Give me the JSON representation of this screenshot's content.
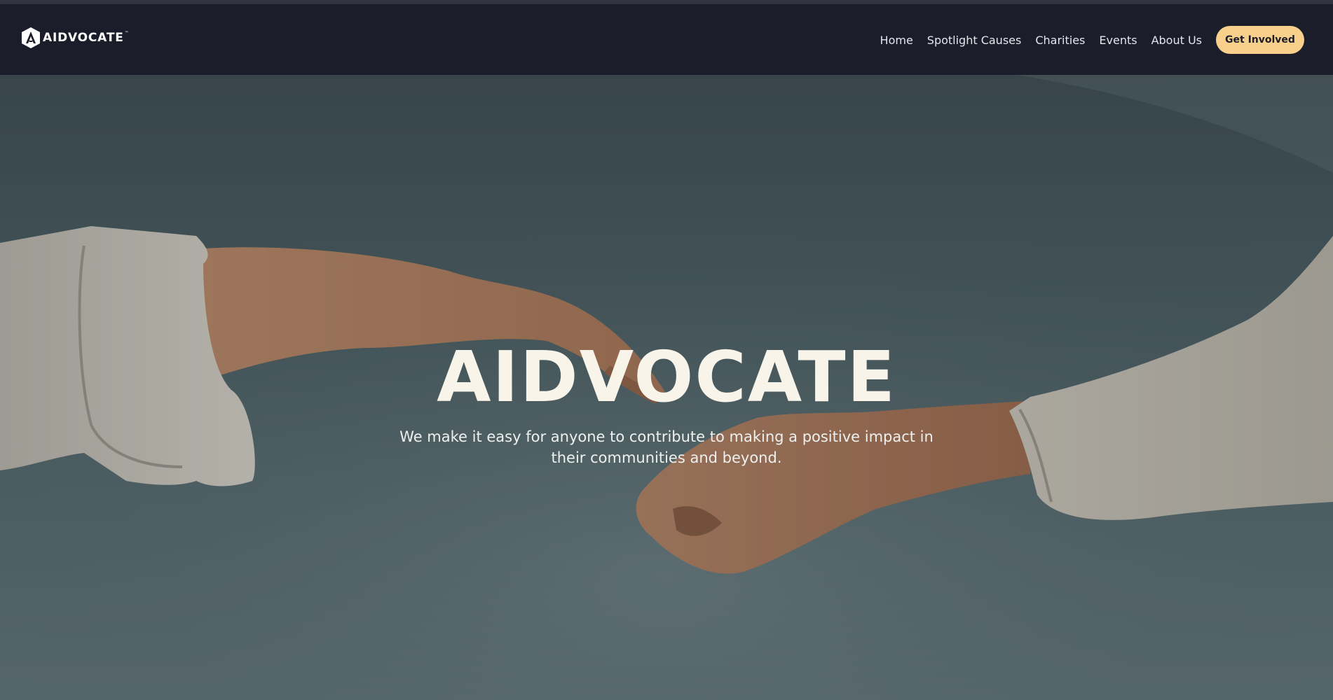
{
  "brand": {
    "name": "AIDVOCATE",
    "trademark": "™",
    "logo_icon": "a-triangle-icon"
  },
  "nav": {
    "links": [
      {
        "label": "Home"
      },
      {
        "label": "Spotlight Causes"
      },
      {
        "label": "Charities"
      },
      {
        "label": "Events"
      },
      {
        "label": "About Us"
      }
    ],
    "cta_label": "Get Involved"
  },
  "hero": {
    "title": "AIDVOCATE",
    "subtitle": "We make it easy for anyone to contribute to making a positive impact in their communities and beyond."
  },
  "colors": {
    "navbar_bg": "#1c1d2b",
    "cta_bg": "#f8d08b",
    "hero_sky": "#4a5d62"
  }
}
